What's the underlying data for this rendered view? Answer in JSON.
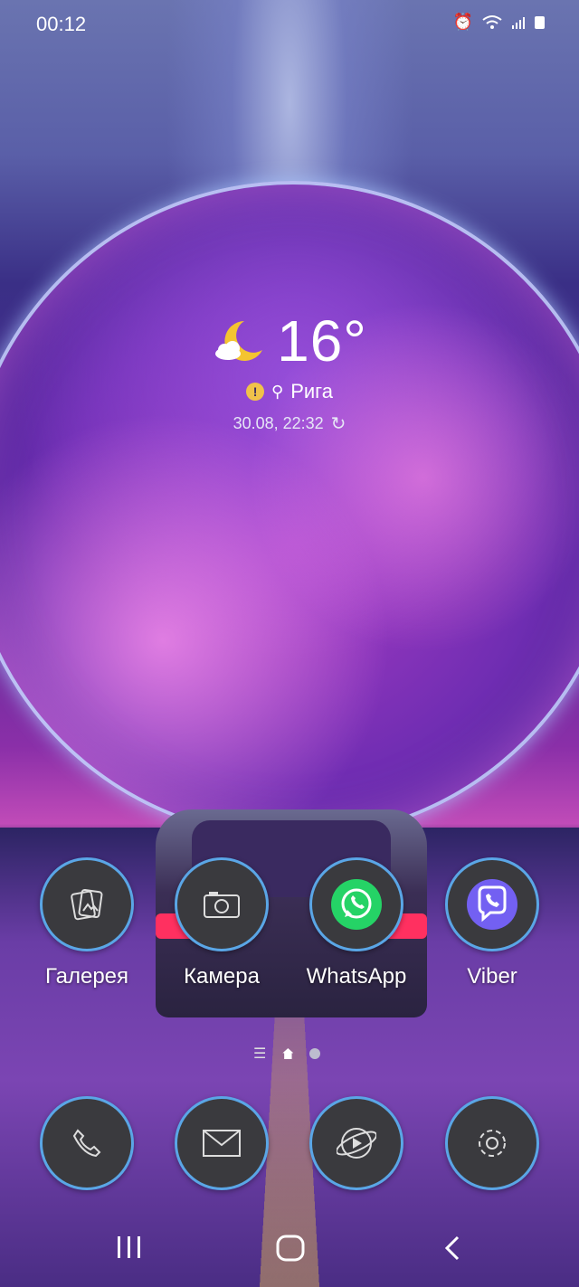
{
  "status_bar": {
    "time": "00:12"
  },
  "weather": {
    "temperature": "16°",
    "location": "Рига",
    "updated": "30.08, 22:32"
  },
  "apps": [
    {
      "label": "Галерея",
      "icon": "gallery-icon"
    },
    {
      "label": "Камера",
      "icon": "camera-icon"
    },
    {
      "label": "WhatsApp",
      "icon": "whatsapp-icon",
      "color": "#25d366"
    },
    {
      "label": "Viber",
      "icon": "viber-icon",
      "color": "#7360f2"
    }
  ],
  "dock": [
    {
      "name": "phone",
      "icon": "phone-icon"
    },
    {
      "name": "messages",
      "icon": "envelope-icon"
    },
    {
      "name": "browser",
      "icon": "globe-icon"
    },
    {
      "name": "settings",
      "icon": "gear-icon"
    }
  ],
  "navigation": {
    "buttons": [
      "recents",
      "home",
      "back"
    ]
  }
}
